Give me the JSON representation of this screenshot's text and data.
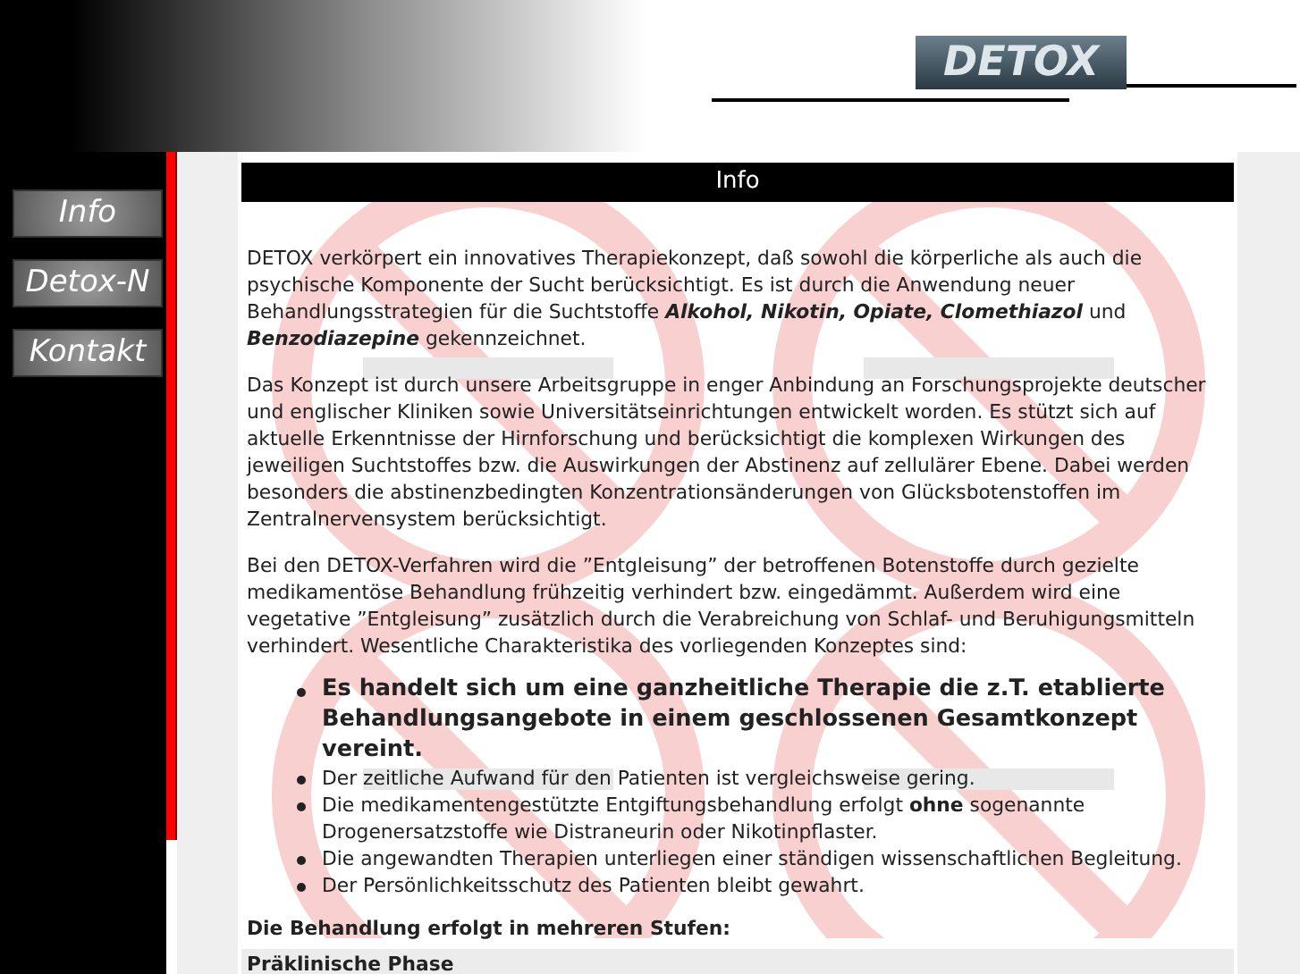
{
  "logo": {
    "text": "DETOX"
  },
  "nav": [
    {
      "label": "Info"
    },
    {
      "label": "Detox-N"
    },
    {
      "label": "Kontakt"
    }
  ],
  "page_title": "Info",
  "paragraphs": [
    {
      "kind": "intro",
      "text": "DETOX verkörpert ein innovatives Therapiekonzept, daß sowohl die körperliche als auch die psychische Komponente der Sucht berücksichtigt. Es ist durch die Anwendung neuer Behandlungsstrategien für die Suchtstoffe **Alkohol, Nikotin, Opiate, Clomethiazol** und **Benzodiazepine** gekennzeichnet."
    },
    {
      "kind": "plain",
      "text": "Das Konzept ist durch unsere Arbeitsgruppe in enger Anbindung an Forschungsprojekte deutscher und englischer Kliniken sowie Universitätseinrichtungen entwickelt worden. Es stützt sich auf aktuelle Erkenntnisse der Hirnforschung und berücksichtigt die komplexen Wirkungen des jeweiligen Suchtstoffes bzw. die Auswirkungen der Abstinenz auf zellulärer Ebene. Dabei werden besonders die abstinenzbedingten Konzentrationsänderungen von Glücksbotenstoffen im Zentralnervensystem berücksichtigt."
    },
    {
      "kind": "plain",
      "text": "Bei den DETOX-Verfahren wird die ”Entgleisung” der betroffenen Botenstoffe durch gezielte medikamentöse Behandlung frühzeitig verhindert bzw. eingedämmt. Außerdem wird eine vegetative ”Entgleisung” zusätzlich durch die Verabreichung von Schlaf- und Beruhigungsmitteln verhindert. Wesentliche Charakteristika des vorliegenden Konzeptes sind:"
    }
  ],
  "features": [
    {
      "kind": "lead",
      "text": "Es handelt sich um eine ganzheitliche Therapie die z.T. etablierte Behandlungsangebote in einem geschlossenen Gesamtkonzept vereint."
    },
    {
      "kind": "normal",
      "text": "Der zeitliche Aufwand für den Patienten ist vergleichsweise gering."
    },
    {
      "kind": "normal",
      "text": "Die medikamentengestützte Entgiftungsbehandlung erfolgt **ohne** sogenannte Drogenersatzstoffe wie Distraneurin oder Nikotinpflaster."
    },
    {
      "kind": "normal",
      "text": "Die angewandten Therapien unterliegen einer ständigen wissenschaftlichen Begleitung."
    },
    {
      "kind": "normal",
      "text": "Der Persönlichkeitsschutz des Patienten bleibt gewahrt."
    }
  ],
  "stages_heading": "Die Behandlung erfolgt in mehreren Stufen:",
  "phase_title": "Präklinische Phase"
}
